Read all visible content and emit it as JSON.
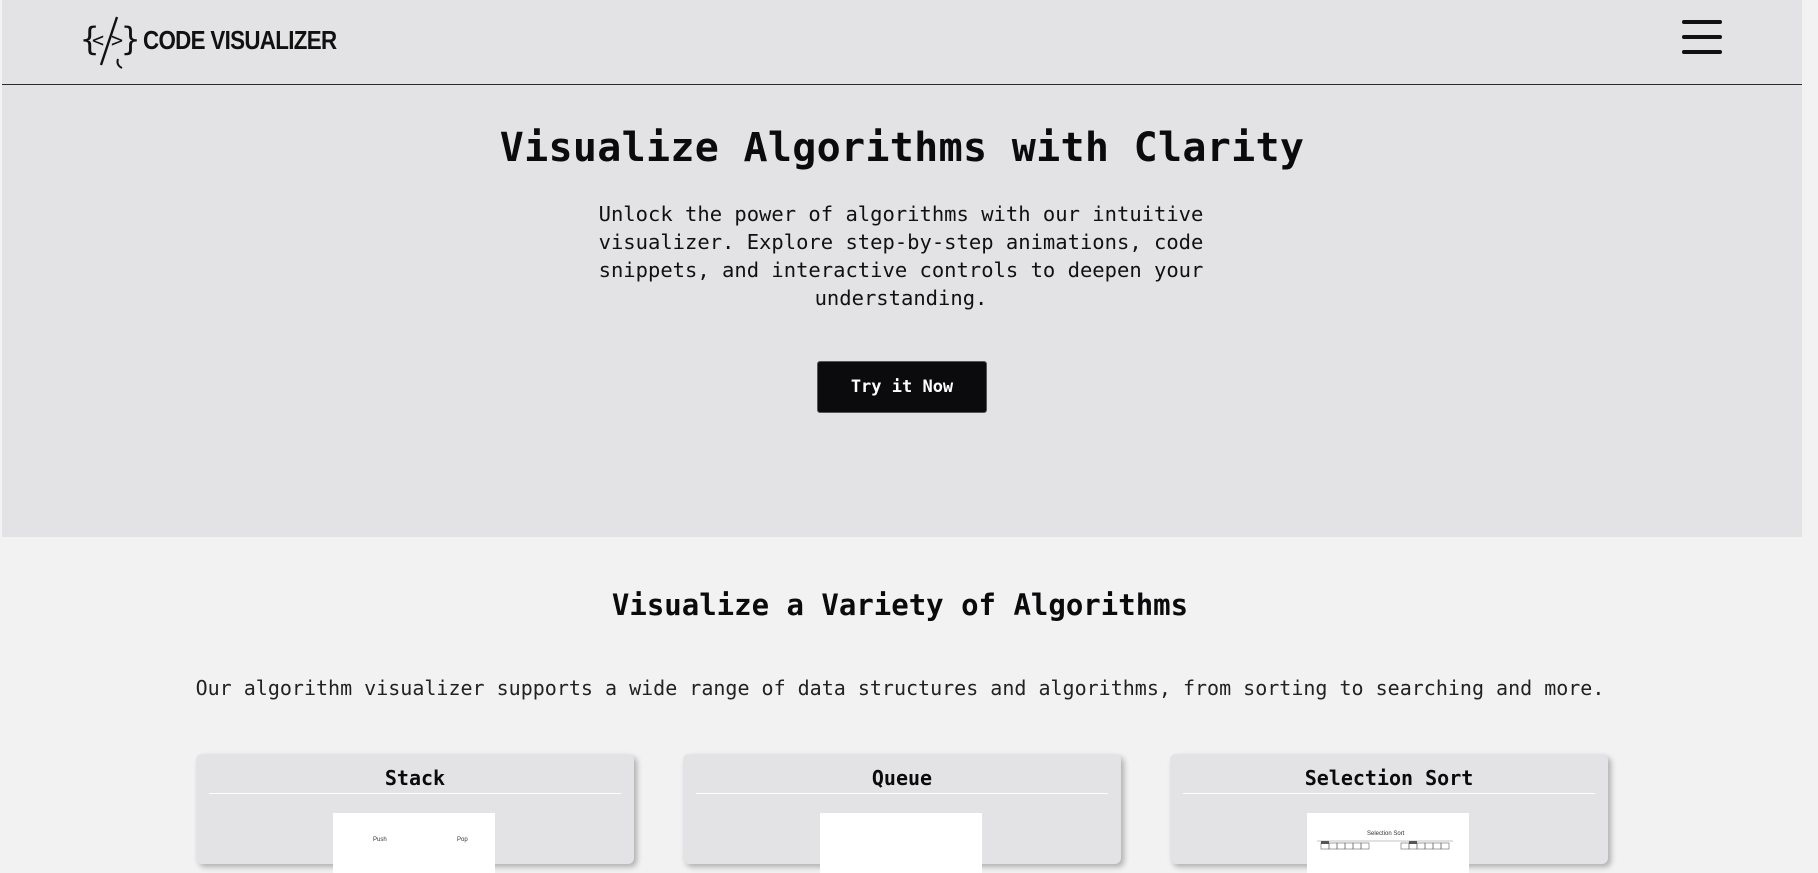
{
  "nav": {
    "logo_text": "CODE VISUALIZER",
    "logo_icon": "code-brackets-icon",
    "menu_icon": "hamburger-menu-icon"
  },
  "hero": {
    "title": "Visualize Algorithms with Clarity",
    "subtitle": "Unlock the power of algorithms with our intuitive visualizer. Explore step-by-step animations, code snippets, and interactive controls to deepen your understanding.",
    "cta_label": "Try it Now"
  },
  "features": {
    "title": "Visualize a Variety of Algorithms",
    "subtitle": "Our algorithm visualizer supports a wide range of data structures and algorithms, from sorting to searching and more.",
    "cards": [
      {
        "title": "Stack",
        "thumb_labels": [
          "Push",
          "Pop"
        ]
      },
      {
        "title": "Queue"
      },
      {
        "title": "Selection Sort",
        "thumb_labels": [
          "Selection Sort"
        ]
      }
    ]
  },
  "colors": {
    "header_bg": "#e3e3e5",
    "hero_bg": "#e3e3e5",
    "page_bg": "#f2f2f2",
    "card_bg": "#e3e3e5",
    "button_bg": "#0b0b0d",
    "text": "#0b0b0d"
  }
}
